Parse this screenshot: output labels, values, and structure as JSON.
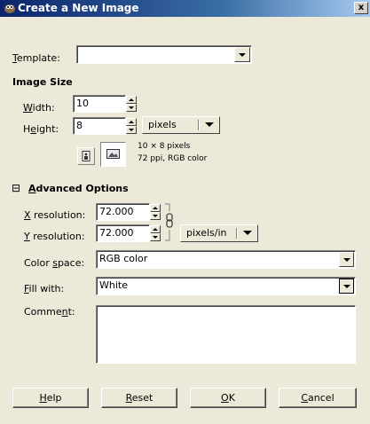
{
  "window": {
    "title": "Create a New Image",
    "close_label": "x"
  },
  "template": {
    "label_pre": "",
    "label_u": "T",
    "label_post": "emplate:",
    "value": ""
  },
  "image_size": {
    "heading": "Image Size",
    "width_label_pre": "",
    "width_label_u": "W",
    "width_label_post": "idth:",
    "width_value": "10",
    "height_label_pre": "H",
    "height_label_u": "e",
    "height_label_post": "ight:",
    "height_value": "8",
    "unit": "pixels",
    "info_line1": "10 × 8 pixels",
    "info_line2": "72 ppi, RGB color"
  },
  "advanced": {
    "expander": "⊟",
    "heading_u": "A",
    "heading_post": "dvanced Options",
    "xres_label_u": "X",
    "xres_label_post": " resolution:",
    "xres_value": "72.000",
    "yres_label_u": "Y",
    "yres_label_post": " resolution:",
    "yres_value": "72.000",
    "res_unit": "pixels/in",
    "colorspace_label_pre": "Color ",
    "colorspace_label_u": "s",
    "colorspace_label_post": "pace:",
    "colorspace_value": "RGB color",
    "fill_label_u": "F",
    "fill_label_post": "ill with:",
    "fill_value": "White",
    "comment_label_pre": "Comme",
    "comment_label_u": "n",
    "comment_label_post": "t:",
    "comment_value": ""
  },
  "buttons": {
    "help_u": "H",
    "help_post": "elp",
    "reset_u": "R",
    "reset_post": "eset",
    "ok_u": "O",
    "ok_post": "K",
    "cancel_u": "C",
    "cancel_post": "ancel"
  },
  "icons": {
    "app": "gimp-wilber-icon",
    "portrait": "portrait-orientation-icon",
    "landscape": "landscape-orientation-icon",
    "chain": "chain-link-icon"
  }
}
